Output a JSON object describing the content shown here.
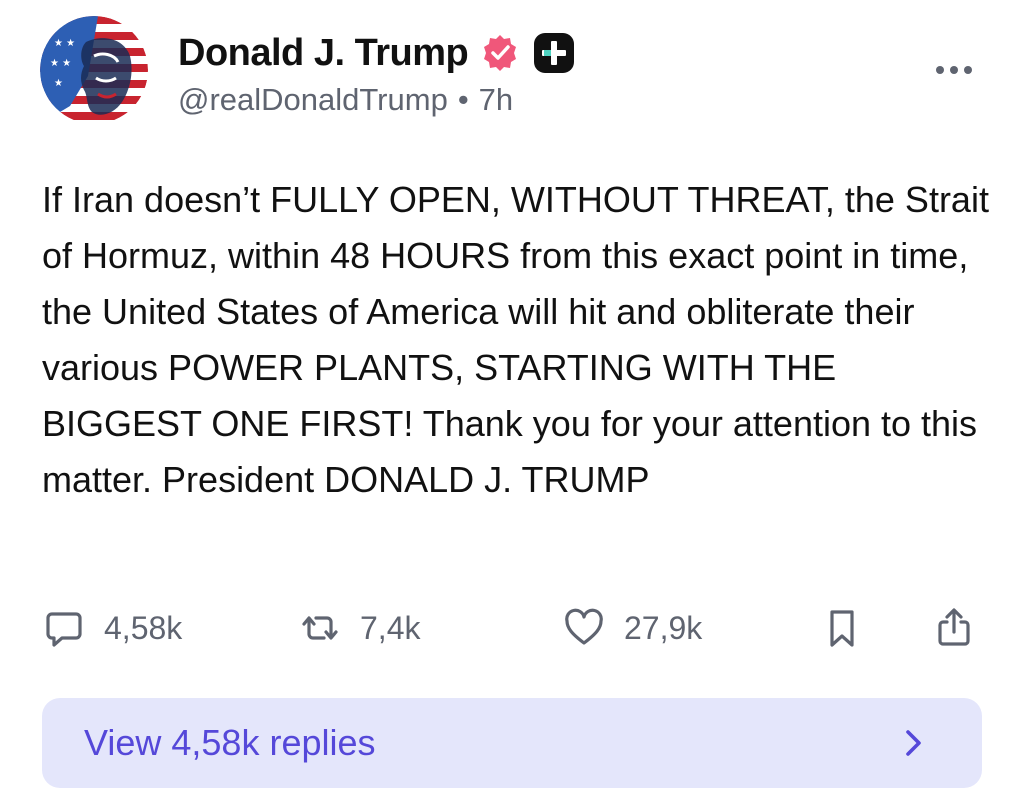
{
  "author": {
    "display_name": "Donald J. Trump",
    "handle": "@realDonaldTrump",
    "separator": "•",
    "time_ago": "7h",
    "verified_color": "#f0577a",
    "plus_badge_color": "#111111"
  },
  "post": {
    "text": "If Iran doesn’t FULLY OPEN, WITHOUT THREAT, the Strait of Hormuz, within 48 HOURS from this exact point in time, the United States of America will hit and obliterate their various POWER PLANTS, STARTING WITH THE BIGGEST ONE FIRST! Thank you for your attention to this matter. President DONALD J. TRUMP"
  },
  "actions": {
    "replies_count": "4,58k",
    "reposts_count": "7,4k",
    "likes_count": "27,9k"
  },
  "replies_button": {
    "label": "View 4,58k replies",
    "background": "#e4e6fb",
    "text_color": "#5548d9"
  },
  "icons": [
    "avatar-image",
    "verified-badge-icon",
    "plus-badge-icon",
    "more-options-icon",
    "reply-icon",
    "repost-icon",
    "like-icon",
    "bookmark-icon",
    "share-icon",
    "chevron-right-icon"
  ]
}
